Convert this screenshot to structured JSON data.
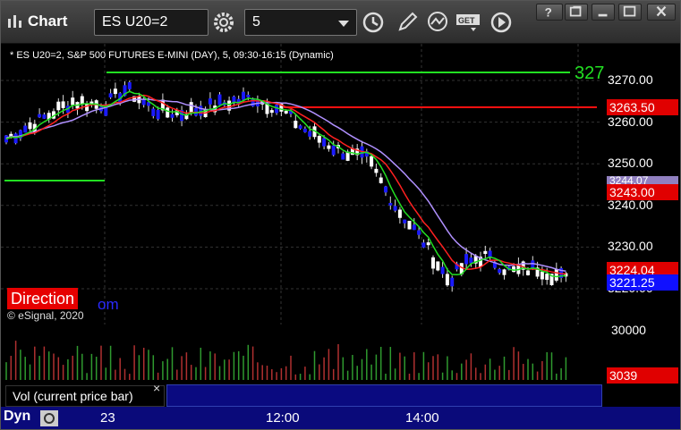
{
  "window": {
    "title": "Chart",
    "symbol_combo": "ES U20=2",
    "interval_combo": "5",
    "buttons": [
      "gear-icon",
      "clock-icon",
      "pencil-icon",
      "indicator-icon",
      "get-icon",
      "play-icon",
      "help-icon",
      "restore-icon",
      "minimize-icon",
      "maximize-icon",
      "close-icon"
    ]
  },
  "chart": {
    "header": "* ES U20=2, S&P 500 FUTURES E-MINI (DAY), 5, 09:30-16:15 (Dynamic)",
    "big_label": "327",
    "price_levels": [
      "3270.00",
      "3260.00",
      "3250.00",
      "3240.00",
      "3230.00",
      "3220.00"
    ],
    "tags": {
      "red_top": "3263.50",
      "grey": "3244.07",
      "red_mid": "3243.00",
      "red_low": "3224.04",
      "blue": "3221.25"
    },
    "direction_badge": "Direction",
    "direction_suffix": "om",
    "copyright": "© eSignal, 2020",
    "colors": {
      "up": "#ffffff",
      "down": "#1a1aff",
      "ema_fast": "#ff2020",
      "ema_slow": "#b090ff",
      "green": "#22e022",
      "red": "#ff1010"
    }
  },
  "volume": {
    "axis_label": "30000",
    "tag": "3039",
    "label": "Vol (current price bar)",
    "close_glyph": "×"
  },
  "time_axis": {
    "labels": [
      "23",
      "12:00",
      "14:00"
    ],
    "left_label": "Dyn"
  }
}
